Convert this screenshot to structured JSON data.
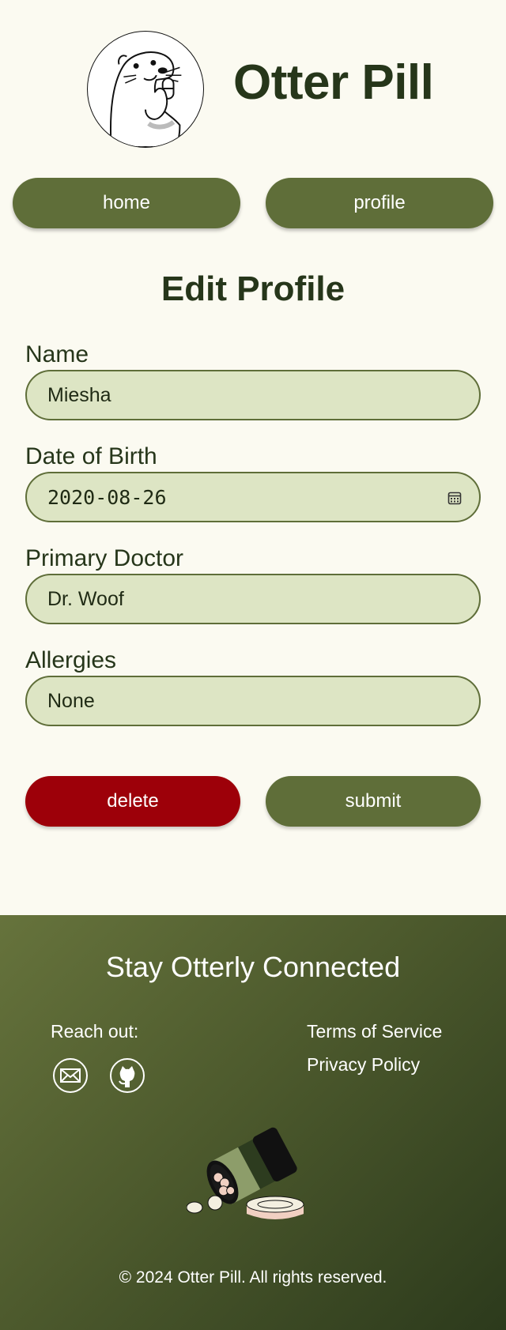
{
  "app": {
    "title": "Otter Pill"
  },
  "nav": {
    "home_label": "home",
    "profile_label": "profile"
  },
  "page": {
    "title": "Edit Profile"
  },
  "form": {
    "name": {
      "label": "Name",
      "value": "Miesha"
    },
    "dob": {
      "label": "Date of Birth",
      "value": "2020-08-26"
    },
    "doctor": {
      "label": "Primary Doctor",
      "value": "Dr. Woof"
    },
    "allergies": {
      "label": "Allergies",
      "value": "None"
    }
  },
  "actions": {
    "delete_label": "delete",
    "submit_label": "submit"
  },
  "footer": {
    "title": "Stay Otterly Connected",
    "reach_label": "Reach out:",
    "terms_label": "Terms of Service",
    "privacy_label": "Privacy Policy",
    "copyright": "© 2024 Otter Pill. All rights reserved."
  },
  "icons": {
    "logo": "otter-logo-icon",
    "calendar": "calendar-icon",
    "mail": "mail-icon",
    "github": "github-icon",
    "illustration": "pill-bottle-icon"
  },
  "colors": {
    "background": "#fbfaf1",
    "primary": "#5f6e39",
    "danger": "#9d0009",
    "input_bg": "#dde5c4",
    "text_dark": "#26361a"
  }
}
